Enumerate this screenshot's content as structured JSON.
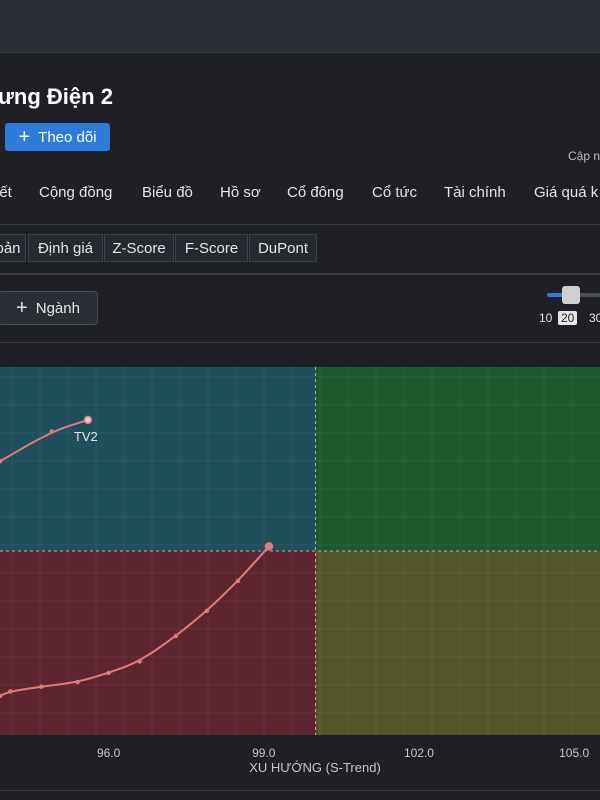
{
  "header": {
    "title": "ưng Điện 2",
    "follow_label": "Theo dõi",
    "update_text": "Cập n"
  },
  "tabs": [
    "iết",
    "Cộng đồng",
    "Biểu đồ",
    "Hồ sơ",
    "Cổ đông",
    "Cổ tức",
    "Tài chính",
    "Giá quá k"
  ],
  "subtabs": [
    "oản",
    "Định giá",
    "Z-Score",
    "F-Score",
    "DuPont"
  ],
  "toolbar": {
    "nganh_label": "Ngành",
    "slider_labels": [
      "10",
      "20",
      "30"
    ],
    "slider_selected": "20"
  },
  "colors": {
    "q_top_left": "#1f4f5c",
    "q_top_right": "#1d5a30",
    "q_bottom_left": "#5c2530",
    "q_bottom_right": "#54562a",
    "trail": "#e07a7a",
    "divider": "#e0a0a0"
  },
  "chart_data": {
    "type": "scatter",
    "xlabel": "XU HƯỚNG (S-Trend)",
    "x_ticks": [
      96.0,
      99.0,
      102.0,
      105.0
    ],
    "x_range": [
      93.9,
      105.5
    ],
    "y_range": [
      92.0,
      108.0
    ],
    "x_split": 100.0,
    "y_split": 100.0,
    "series": [
      {
        "name": "TV2",
        "points": [
          {
            "x": 93.9,
            "y": 103.9
          },
          {
            "x": 94.9,
            "y": 105.2
          },
          {
            "x": 95.6,
            "y": 105.7
          }
        ]
      },
      {
        "name": "",
        "points": [
          {
            "x": 93.9,
            "y": 93.7
          },
          {
            "x": 94.1,
            "y": 93.9
          },
          {
            "x": 94.7,
            "y": 94.1
          },
          {
            "x": 95.4,
            "y": 94.3
          },
          {
            "x": 96.0,
            "y": 94.7
          },
          {
            "x": 96.6,
            "y": 95.2
          },
          {
            "x": 97.3,
            "y": 96.3
          },
          {
            "x": 97.9,
            "y": 97.4
          },
          {
            "x": 98.5,
            "y": 98.7
          },
          {
            "x": 99.1,
            "y": 100.2
          }
        ]
      }
    ]
  }
}
